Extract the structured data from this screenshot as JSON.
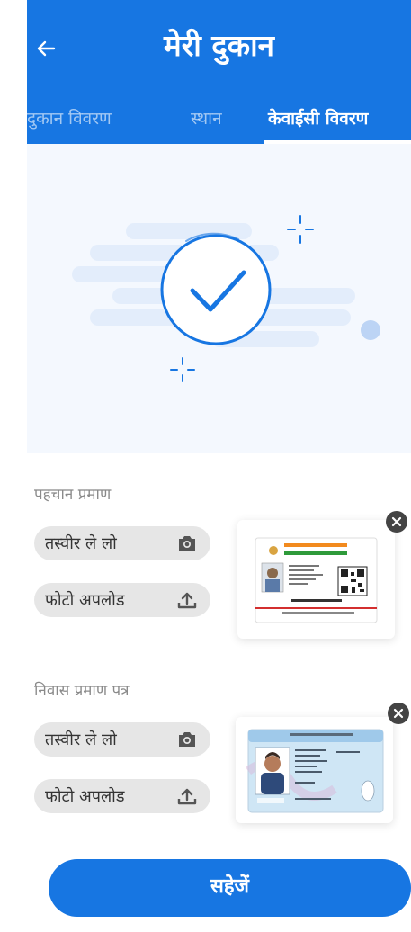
{
  "header": {
    "back_icon": "arrow-left-icon",
    "title": "मेरी दुकान",
    "tabs": [
      {
        "label": "दुकान विवरण",
        "active": false
      },
      {
        "label": "स्थान",
        "active": false
      },
      {
        "label": "केवाईसी विवरण",
        "active": true
      }
    ]
  },
  "illustration": {
    "icon": "checkmark-circle-icon",
    "status": "verified"
  },
  "documents": [
    {
      "label": "पहचान प्रमाण",
      "camera_label": "तस्वीर ले लो",
      "camera_icon": "camera-icon",
      "upload_label": "फोटो अपलोड",
      "upload_icon": "upload-icon",
      "thumbnail": "aadhaar-card-image",
      "remove_icon": "close-circle-icon"
    },
    {
      "label": "निवास प्रमाण पत्र",
      "camera_label": "तस्वीर ले लो",
      "camera_icon": "camera-icon",
      "upload_label": "फोटो अपलोड",
      "upload_icon": "upload-icon",
      "thumbnail": "pan-card-image",
      "remove_icon": "close-circle-icon"
    }
  ],
  "save_button": {
    "label": "सहेजें"
  },
  "colors": {
    "primary": "#1776e2",
    "hero_bg": "#f4f8fe",
    "pill_bg": "#e6e6e6",
    "label_gray": "#8a8a8a"
  }
}
